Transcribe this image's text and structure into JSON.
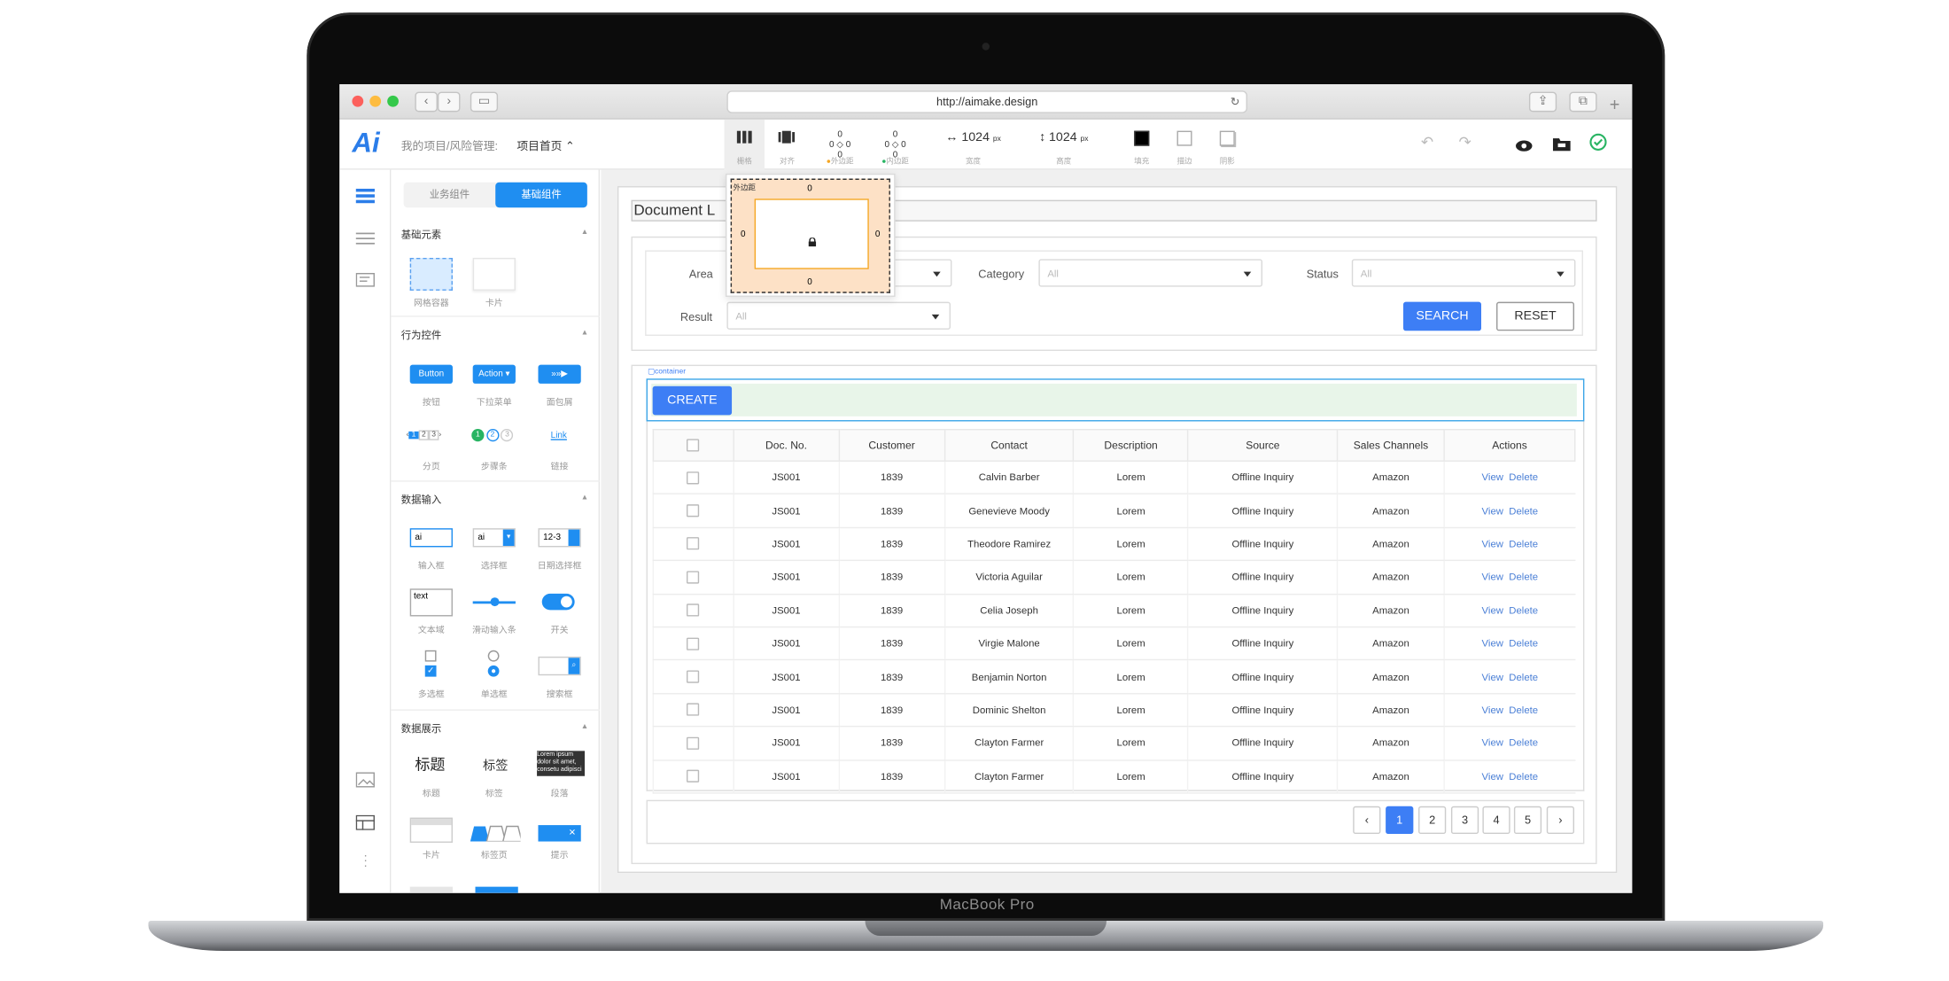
{
  "device": {
    "brand": "MacBook Pro"
  },
  "browser": {
    "url": "http://aimake.design"
  },
  "app": {
    "logo": "Ai",
    "breadcrumb": "我的项目/风险管理:",
    "page_select": "项目首页 ⌃"
  },
  "toolbar": {
    "grid": "栅格",
    "align": "对齐",
    "margin": "外边距",
    "padding": "内边距",
    "width_val": "1024",
    "height_val": "1024",
    "px": "px",
    "width": "宽度",
    "height": "高度",
    "fill": "填充",
    "stroke": "描边",
    "shadow": "阴影",
    "zero": "0"
  },
  "panel": {
    "tab_business": "业务组件",
    "tab_basic": "基础组件",
    "sec_basic": "基础元素",
    "sec_action": "行为控件",
    "sec_input": "数据输入",
    "sec_display": "数据展示",
    "grid_container": "网格容器",
    "card": "卡片",
    "btn_sample": "Button",
    "action_sample": "Action ▾",
    "button": "按钮",
    "dropdown": "下拉菜单",
    "breadcrumb": "面包屑",
    "link_sample": "Link",
    "pagination": "分页",
    "steps": "步骤条",
    "link": "链接",
    "input_sample": "ai",
    "select_sample": "ai",
    "date_sample": "12-3",
    "input": "输入框",
    "select": "选择框",
    "datepicker": "日期选择框",
    "textarea_sample": "text",
    "textarea": "文本域",
    "slider": "滑动输入条",
    "switch": "开关",
    "checkbox": "多选框",
    "radio": "单选框",
    "searchbox": "搜索框",
    "title_sample": "标题",
    "tag_sample": "标签",
    "para_sample": "Lorem ipsum dolor sit amet, consetu adipisci",
    "title": "标题",
    "tag": "标签",
    "paragraph": "段落",
    "card2": "卡片",
    "tabs": "标签页",
    "alert": "提示",
    "pg_nums": [
      "1",
      "2",
      "3"
    ],
    "step_nums": [
      "1",
      "2",
      "3"
    ]
  },
  "popover": {
    "title": "外边距",
    "top": "0",
    "bottom": "0",
    "left": "0",
    "right": "0"
  },
  "doc": {
    "title": "Document L"
  },
  "filters": {
    "area": "Area",
    "category": "Category",
    "status": "Status",
    "result": "Result",
    "all": "All",
    "search": "SEARCH",
    "reset": "RESET"
  },
  "container_label": "container",
  "create": "CREATE",
  "table": {
    "headers": [
      "",
      "Doc. No.",
      "Customer",
      "Contact",
      "Description",
      "Source",
      "Sales Channels",
      "Actions"
    ],
    "view": "View",
    "delete": "Delete",
    "rows": [
      [
        "JS001",
        "1839",
        "Calvin Barber",
        "Lorem",
        "Offline Inquiry",
        "Amazon"
      ],
      [
        "JS001",
        "1839",
        "Genevieve Moody",
        "Lorem",
        "Offline Inquiry",
        "Amazon"
      ],
      [
        "JS001",
        "1839",
        "Theodore Ramirez",
        "Lorem",
        "Offline Inquiry",
        "Amazon"
      ],
      [
        "JS001",
        "1839",
        "Victoria Aguilar",
        "Lorem",
        "Offline Inquiry",
        "Amazon"
      ],
      [
        "JS001",
        "1839",
        "Celia Joseph",
        "Lorem",
        "Offline Inquiry",
        "Amazon"
      ],
      [
        "JS001",
        "1839",
        "Virgie Malone",
        "Lorem",
        "Offline Inquiry",
        "Amazon"
      ],
      [
        "JS001",
        "1839",
        "Benjamin Norton",
        "Lorem",
        "Offline Inquiry",
        "Amazon"
      ],
      [
        "JS001",
        "1839",
        "Dominic Shelton",
        "Lorem",
        "Offline Inquiry",
        "Amazon"
      ],
      [
        "JS001",
        "1839",
        "Clayton Farmer",
        "Lorem",
        "Offline Inquiry",
        "Amazon"
      ],
      [
        "JS001",
        "1839",
        "Clayton Farmer",
        "Lorem",
        "Offline Inquiry",
        "Amazon"
      ]
    ]
  },
  "pager": {
    "prev": "‹",
    "next": "›",
    "pages": [
      "1",
      "2",
      "3",
      "4",
      "5"
    ],
    "current": "1"
  },
  "colors": {
    "accent": "#3d7ef5",
    "button_blue": "#1f8ef1",
    "success": "#28b463"
  }
}
